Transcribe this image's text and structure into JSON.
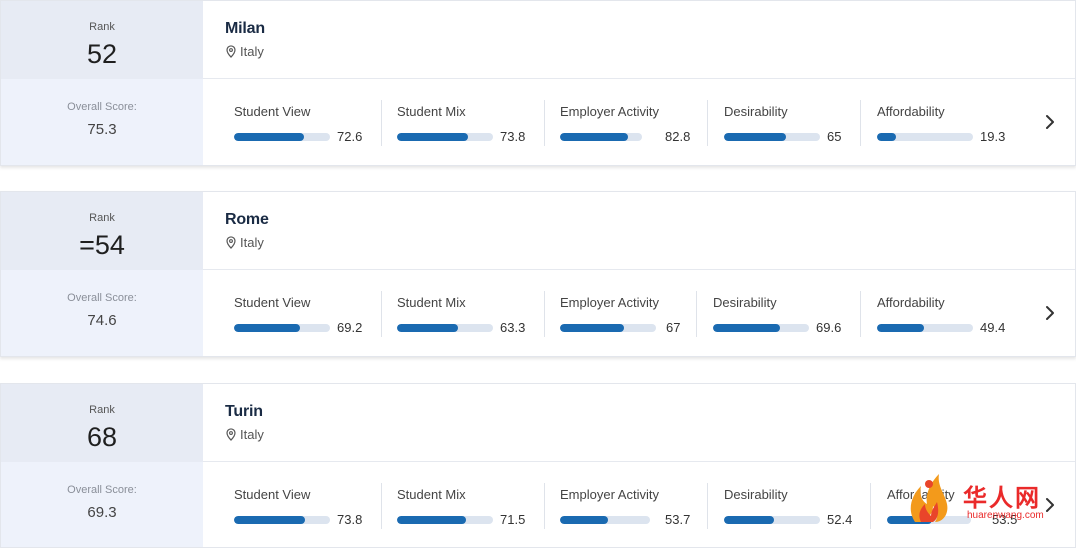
{
  "labels": {
    "rank": "Rank",
    "overall_score": "Overall Score:"
  },
  "colors": {
    "bar_fill": "#1a6ab1",
    "bar_track": "#dce4ef",
    "rank_bg": "#e7ebf4",
    "score_bg": "#eef2fb"
  },
  "cities": [
    {
      "rank": "52",
      "name": "Milan",
      "country": "Italy",
      "overall_score": "75.3",
      "metrics": [
        {
          "label": "Student View",
          "value": "72.6",
          "fill": 0.726
        },
        {
          "label": "Student Mix",
          "value": "73.8",
          "fill": 0.738
        },
        {
          "label": "Employer Activity",
          "value": "82.8",
          "fill": 0.828
        },
        {
          "label": "Desirability",
          "value": "65",
          "fill": 0.65
        },
        {
          "label": "Affordability",
          "value": "19.3",
          "fill": 0.193
        }
      ]
    },
    {
      "rank": "=54",
      "name": "Rome",
      "country": "Italy",
      "overall_score": "74.6",
      "metrics": [
        {
          "label": "Student View",
          "value": "69.2",
          "fill": 0.692
        },
        {
          "label": "Student Mix",
          "value": "63.3",
          "fill": 0.633
        },
        {
          "label": "Employer Activity",
          "value": "67",
          "fill": 0.67
        },
        {
          "label": "Desirability",
          "value": "69.6",
          "fill": 0.696
        },
        {
          "label": "Affordability",
          "value": "49.4",
          "fill": 0.494
        }
      ]
    },
    {
      "rank": "68",
      "name": "Turin",
      "country": "Italy",
      "overall_score": "69.3",
      "metrics": [
        {
          "label": "Student View",
          "value": "73.8",
          "fill": 0.738
        },
        {
          "label": "Student Mix",
          "value": "71.5",
          "fill": 0.715
        },
        {
          "label": "Employer Activity",
          "value": "53.7",
          "fill": 0.537
        },
        {
          "label": "Desirability",
          "value": "52.4",
          "fill": 0.524
        },
        {
          "label": "Affordability",
          "value": "53.5",
          "fill": 0.535
        }
      ]
    }
  ],
  "watermark": {
    "chinese": "华人网",
    "domain": "huarenwang.com"
  }
}
